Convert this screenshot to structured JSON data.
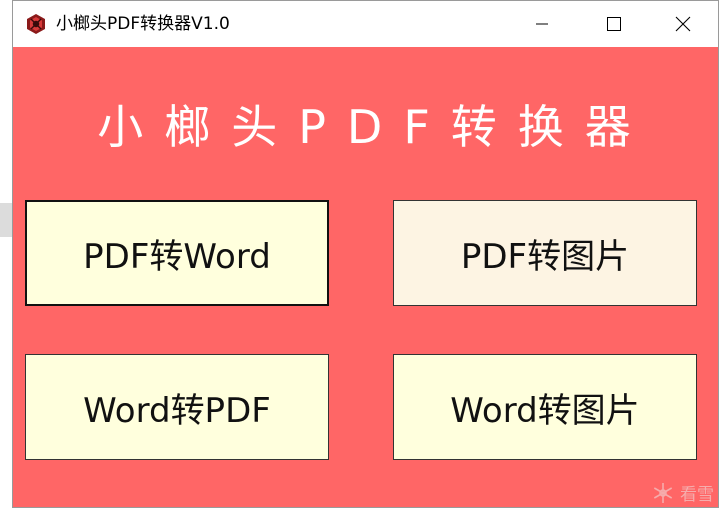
{
  "window": {
    "title": "小榔头PDF转换器V1.0",
    "icon": "hammer-app-icon",
    "controls": {
      "minimize_icon": "minimize-icon",
      "maximize_icon": "maximize-icon",
      "close_icon": "close-icon"
    }
  },
  "main": {
    "heading": "小榔头PDF转换器",
    "background_color": "#ff6666",
    "buttons": [
      {
        "label": "PDF转Word"
      },
      {
        "label": "PDF转图片"
      },
      {
        "label": "Word转PDF"
      },
      {
        "label": "Word转图片"
      }
    ]
  },
  "watermark": {
    "text": "看雪",
    "icon": "snowflake-icon"
  }
}
